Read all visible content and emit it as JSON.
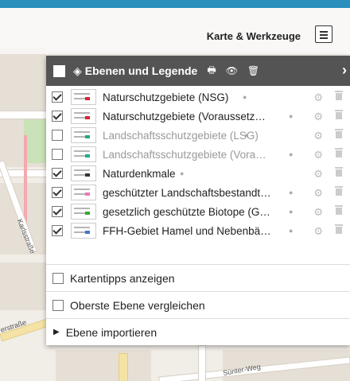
{
  "topbar": {
    "title": "Karte & Werkzeuge"
  },
  "map": {
    "streets": [
      "erstraße",
      "Karlsstraße",
      "Sünter-Weg"
    ]
  },
  "panel": {
    "title": "Ebenen und Legende",
    "layers": [
      {
        "name": "Naturschutzgebiete (NSG)",
        "checked": true,
        "dim": false,
        "info": true
      },
      {
        "name": "Naturschutzgebiete (Voraussetz…",
        "checked": true,
        "dim": false,
        "info": true
      },
      {
        "name": "Landschaftsschutzgebiete (LSG)",
        "checked": false,
        "dim": true,
        "info": true
      },
      {
        "name": "Landschaftsschutzgebiete (Vora…",
        "checked": false,
        "dim": true,
        "info": true
      },
      {
        "name": "Naturdenkmale",
        "checked": true,
        "dim": false,
        "info": true
      },
      {
        "name": "geschützter Landschaftsbestandt…",
        "checked": true,
        "dim": false,
        "info": true
      },
      {
        "name": "gesetzlich geschützte Biotope (G…",
        "checked": true,
        "dim": false,
        "info": true
      },
      {
        "name": "FFH-Gebiet Hamel und Nebenbä…",
        "checked": true,
        "dim": false,
        "info": true
      }
    ],
    "options": {
      "kartentipps": "Kartentipps anzeigen",
      "oberste": "Oberste Ebene vergleichen",
      "import": "Ebene importieren"
    }
  },
  "colors": {
    "header": "#545454",
    "accent": "#2a8fbd"
  }
}
